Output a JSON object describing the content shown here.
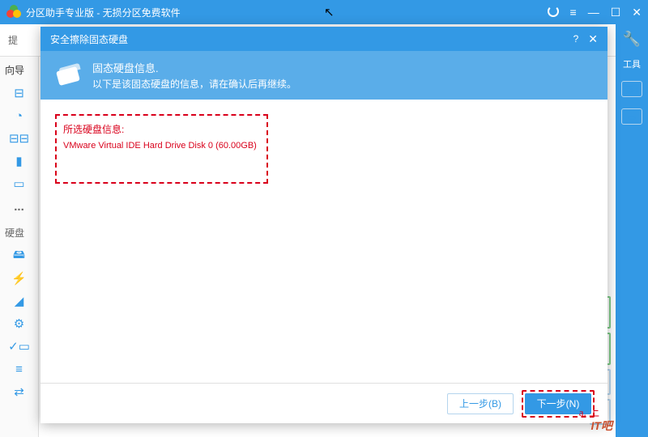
{
  "app": {
    "title": "分区助手专业版 - 无损分区免费软件"
  },
  "titlebar_controls": {
    "refresh": "↻",
    "menu": "≡",
    "min": "—",
    "max": "☐",
    "close": "✕"
  },
  "right_tools": {
    "wrench_label": "工具"
  },
  "sub_toolbar": {
    "text": "提"
  },
  "nav": {
    "wizard_header": "向导",
    "hdd_header": "硬盘",
    "more": "..."
  },
  "modal": {
    "title": "安全擦除固态硬盘",
    "help": "?",
    "close": "✕",
    "header_title": "固态硬盘信息.",
    "header_sub": "以下是该固态硬盘的信息，请在确认后再继续。",
    "info_label": "所选硬盘信息:",
    "info_value": "VMware Virtual IDE Hard Drive Disk 0 (60.00GB)",
    "btn_back": "上一步(B)",
    "btn_next": "下一步(N)"
  },
  "annotation": "a. 上",
  "watermark": "IT吧"
}
